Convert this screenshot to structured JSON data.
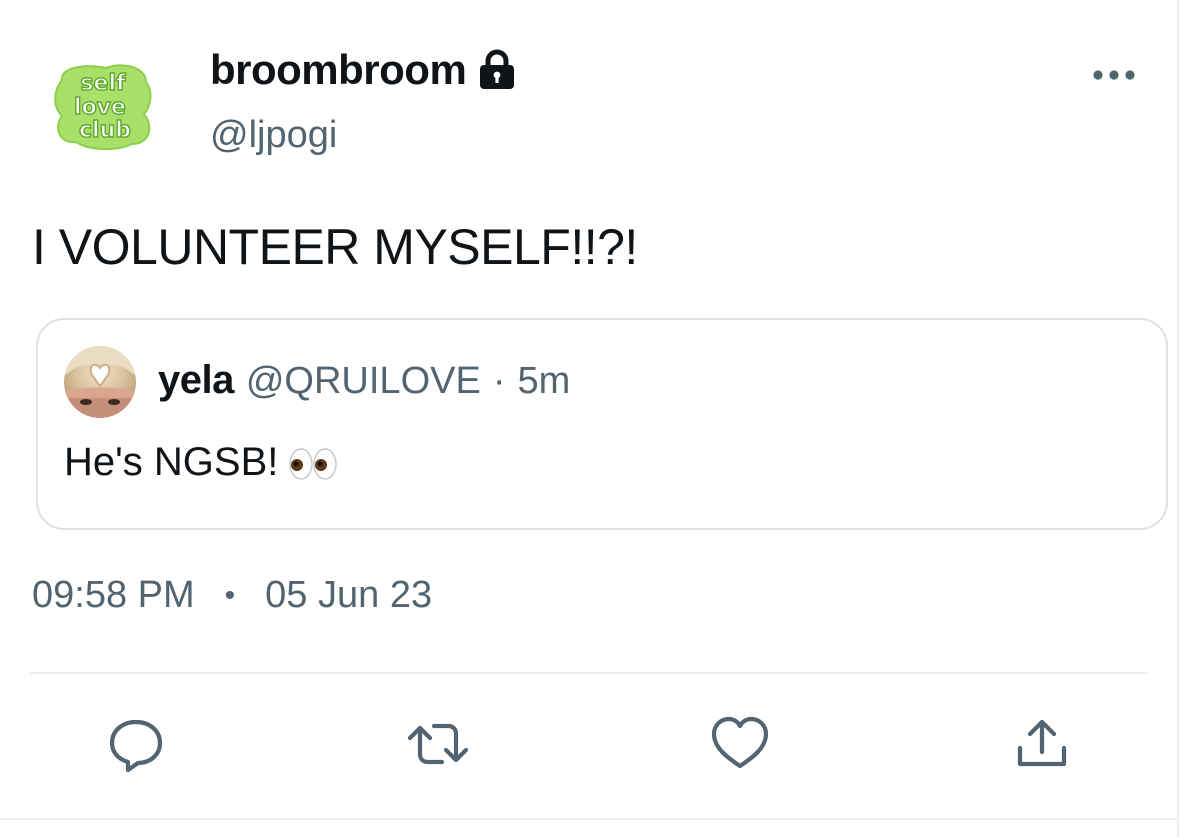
{
  "author": {
    "display_name": "broombroom",
    "handle": "@ljpogi",
    "avatar_text": [
      "self",
      "love",
      "club"
    ],
    "avatar_color": "#a8e06a",
    "protected_icon": "lock-icon"
  },
  "tweet": {
    "text": "I VOLUNTEER MYSELF!!?!",
    "time": "09:58 PM",
    "separator": "•",
    "date": "05 Jun 23"
  },
  "quoted_tweet": {
    "display_name": "yela",
    "handle": "@QRUILOVE",
    "separator": "·",
    "relative_time": "5m",
    "text": "He's NGSB!",
    "emoji_icon": "eyes-icon"
  },
  "actions": [
    {
      "name": "reply",
      "icon": "reply-icon"
    },
    {
      "name": "retweet",
      "icon": "retweet-icon"
    },
    {
      "name": "like",
      "icon": "heart-icon"
    },
    {
      "name": "share",
      "icon": "share-icon"
    }
  ],
  "colors": {
    "text_primary": "#0f1419",
    "text_secondary": "#536471",
    "border": "#dbe2e7"
  }
}
